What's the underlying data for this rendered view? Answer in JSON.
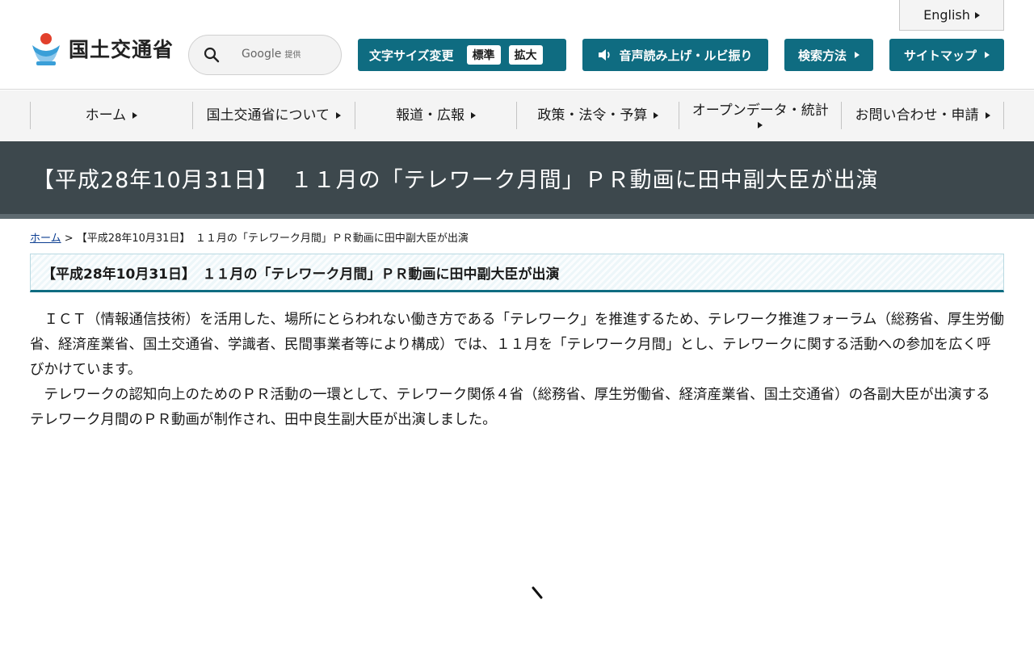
{
  "header": {
    "english_label": "English",
    "logo_text": "国土交通省",
    "search": {
      "placeholder": "",
      "brand": "Google",
      "brand_suffix": "提供"
    },
    "font_size": {
      "label": "文字サイズ変更",
      "standard": "標準",
      "large": "拡大"
    },
    "voice_label": "音声読み上げ・ルビ振り",
    "search_method_label": "検索方法",
    "sitemap_label": "サイトマップ"
  },
  "nav": {
    "items": [
      {
        "label": "ホーム"
      },
      {
        "label": "国土交通省について"
      },
      {
        "label": "報道・広報"
      },
      {
        "label": "政策・法令・予算"
      },
      {
        "label": "オープンデータ・統計"
      },
      {
        "label": "お問い合わせ・申請"
      }
    ]
  },
  "page": {
    "title": "【平成28年10月31日】　１１月の「テレワーク月間」ＰＲ動画に田中副大臣が出演",
    "breadcrumb": {
      "home": "ホーム",
      "separator": " > ",
      "current": "【平成28年10月31日】　１１月の「テレワーク月間」ＰＲ動画に田中副大臣が出演"
    },
    "heading": "【平成28年10月31日】　１１月の「テレワーク月間」ＰＲ動画に田中副大臣が出演",
    "paragraphs": [
      "ＩＣＴ（情報通信技術）を活用した、場所にとらわれない働き方である「テレワーク」を推進するため、テレワーク推進フォーラム（総務省、厚生労働省、経済産業省、国土交通省、学識者、民間事業者等により構成）では、１１月を「テレワーク月間」とし、テレワークに関する活動への参加を広く呼びかけています。",
      "テレワークの認知向上のためのＰＲ活動の一環として、テレワーク関係４省（総務省、厚生労働省、経済産業省、国土交通省）の各副大臣が出演するテレワーク月間のＰＲ動画が制作され、田中良生副大臣が出演しました。"
    ]
  },
  "colors": {
    "accent": "#0f6c81",
    "title_band": "#3d484d",
    "nav_bg": "#f4f4f4"
  }
}
